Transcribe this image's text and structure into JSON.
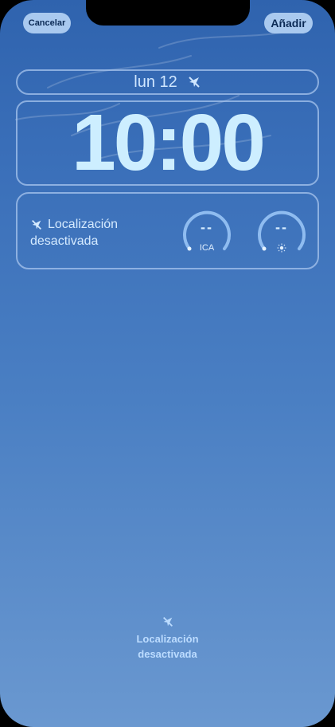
{
  "header": {
    "cancel_label": "Cancelar",
    "add_label": "Añadir"
  },
  "lockscreen": {
    "date": "lun 12",
    "time": "10:00"
  },
  "widgets": {
    "location_line1": "Localización",
    "location_line2": "desactivada",
    "gauges": [
      {
        "value": "--",
        "label": "ICA"
      },
      {
        "value": "--",
        "label": "sun-icon"
      }
    ]
  },
  "footer": {
    "location_line1": "Localización",
    "location_line2": "desactivada"
  },
  "icons": [
    "location-slash-icon",
    "sun-icon"
  ],
  "colors": {
    "accent": "#a9c9ef",
    "text": "#cdeeff",
    "background_top": "#2f63ae",
    "background_bottom": "#6a98d0"
  }
}
